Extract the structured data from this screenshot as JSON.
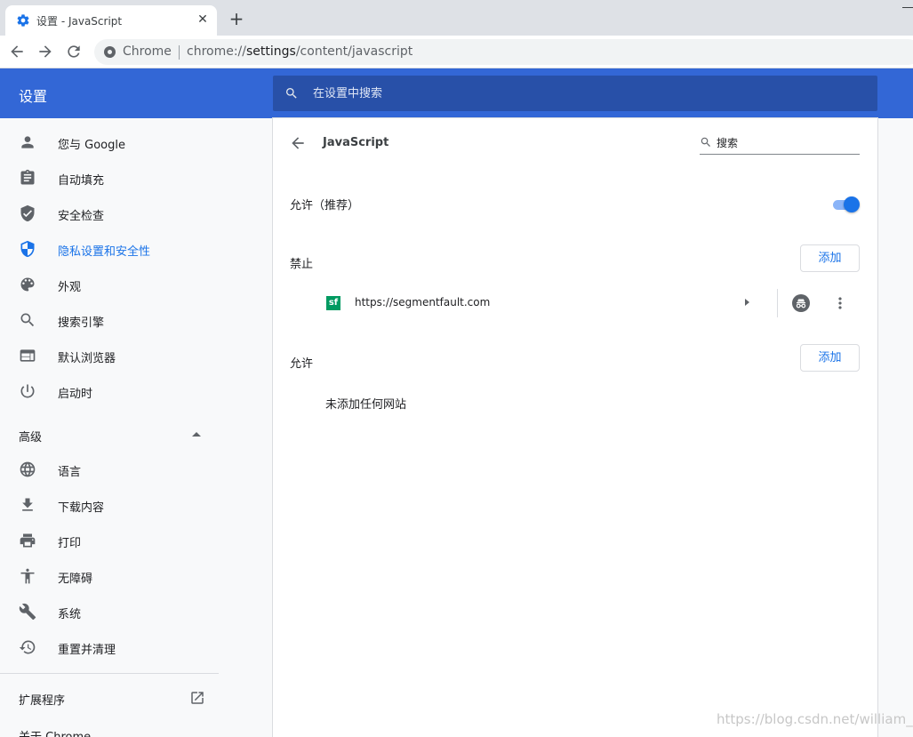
{
  "browser": {
    "tab_title": "设置 - JavaScript",
    "tab_icon": "gear-icon",
    "new_tab_label": "+",
    "close_label": "✕",
    "omnibox": {
      "chip": "Chrome",
      "scheme": "chrome://",
      "host": "settings",
      "path": "/content/javascript"
    }
  },
  "header": {
    "title": "设置",
    "search_placeholder": "在设置中搜索"
  },
  "sidebar": {
    "items": [
      {
        "label": "您与 Google",
        "icon": "person-icon"
      },
      {
        "label": "自动填充",
        "icon": "clipboard-icon"
      },
      {
        "label": "安全检查",
        "icon": "shield-check-icon"
      },
      {
        "label": "隐私设置和安全性",
        "icon": "shield-half-icon",
        "active": true
      },
      {
        "label": "外观",
        "icon": "palette-icon"
      },
      {
        "label": "搜索引擎",
        "icon": "search-icon"
      },
      {
        "label": "默认浏览器",
        "icon": "browser-window-icon"
      },
      {
        "label": "启动时",
        "icon": "power-icon"
      }
    ],
    "advanced_label": "高级",
    "advanced_items": [
      {
        "label": "语言",
        "icon": "globe-icon"
      },
      {
        "label": "下载内容",
        "icon": "download-icon"
      },
      {
        "label": "打印",
        "icon": "printer-icon"
      },
      {
        "label": "无障碍",
        "icon": "accessibility-icon"
      },
      {
        "label": "系统",
        "icon": "wrench-icon"
      },
      {
        "label": "重置并清理",
        "icon": "history-icon"
      }
    ],
    "extensions_label": "扩展程序",
    "about_label": "关于 Chrome"
  },
  "main": {
    "title": "JavaScript",
    "search_placeholder": "搜索",
    "allow_recommended_label": "允许（推荐）",
    "allow_toggle_on": true,
    "blocked_label": "禁止",
    "add_label": "添加",
    "blocked_sites": [
      {
        "url": "https://segmentfault.com",
        "favicon_text": "sf",
        "favicon_color": "#009a61"
      }
    ],
    "allowed_label": "允许",
    "allowed_empty": "未添加任何网站"
  },
  "watermark": "https://blog.csdn.net/william_n",
  "colors": {
    "accent": "#1a73e8",
    "header_bg": "#3367d6",
    "search_bg": "#2850a8"
  }
}
